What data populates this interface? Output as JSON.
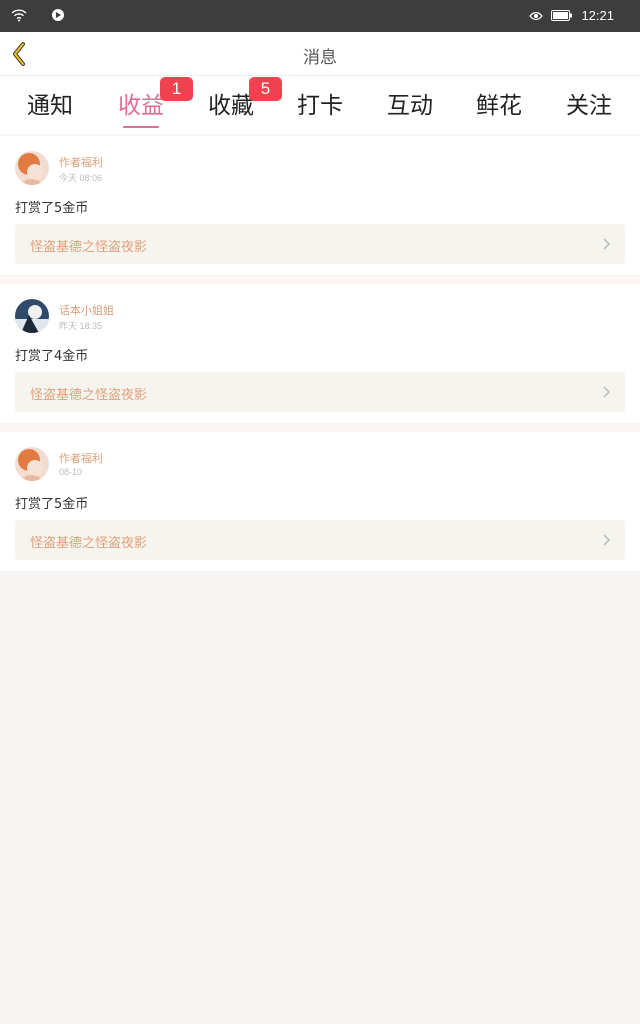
{
  "status_bar": {
    "time": "12:21",
    "icons": [
      "wifi-icon",
      "notification-app-icon",
      "eye-icon",
      "battery-icon"
    ]
  },
  "header": {
    "title": "消息",
    "back_icon": "chevron-left-icon"
  },
  "tabs": [
    {
      "label": "通知",
      "active": false
    },
    {
      "label": "收益",
      "active": true,
      "badge": "1"
    },
    {
      "label": "收藏",
      "active": false,
      "badge": "5"
    },
    {
      "label": "打卡",
      "active": false
    },
    {
      "label": "互动",
      "active": false
    },
    {
      "label": "鲜花",
      "active": false
    },
    {
      "label": "关注",
      "active": false
    }
  ],
  "messages": [
    {
      "user": "作者福利",
      "time": "今天 08:06",
      "text": "打赏了5金币",
      "book": "怪盗基德之怪盗夜影"
    },
    {
      "user": "话本小姐姐",
      "time": "昨天 18:35",
      "text": "打赏了4金币",
      "book": "怪盗基德之怪盗夜影"
    },
    {
      "user": "作者福利",
      "time": "08-10",
      "text": "打赏了5金币",
      "book": "怪盗基德之怪盗夜影"
    }
  ],
  "colors": {
    "accent": "#e56a94",
    "badge": "#f24250",
    "username": "#d9a07c",
    "book_link_bg": "#f5f4ee",
    "book_link_text": "#e0a07a"
  }
}
